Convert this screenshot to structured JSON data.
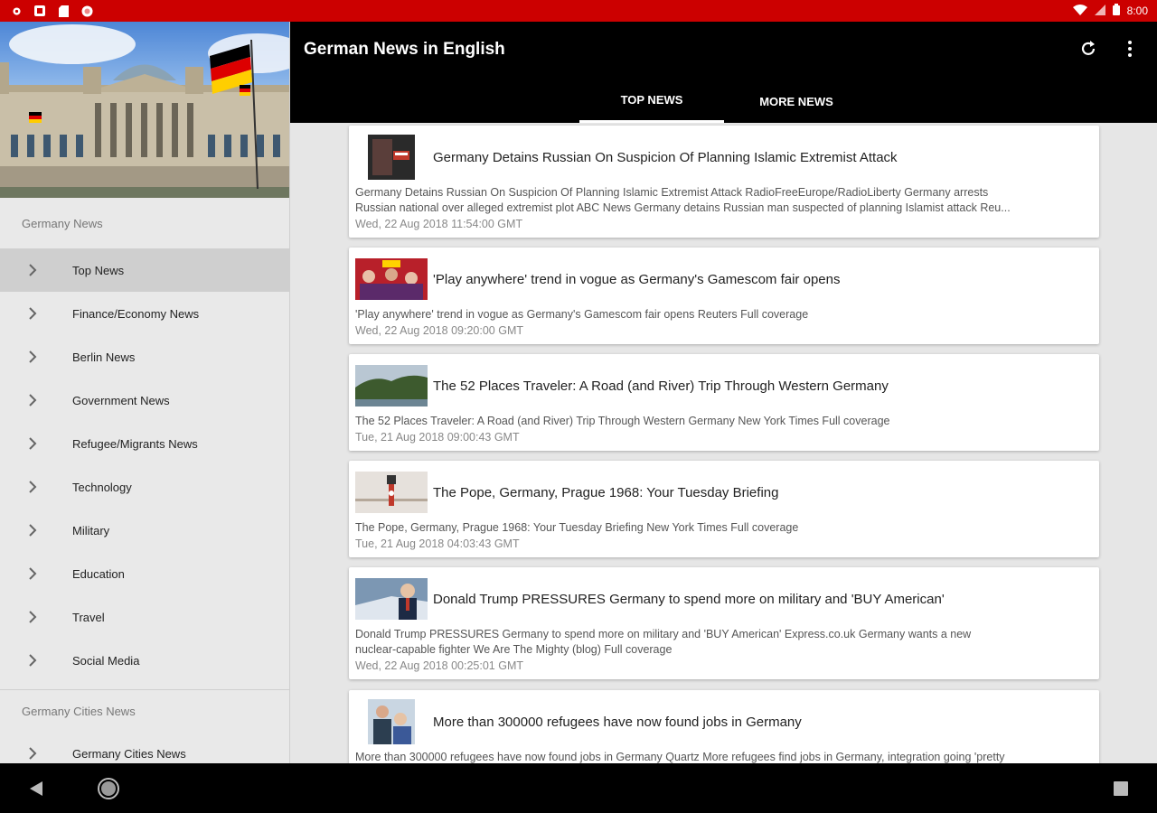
{
  "status_bar": {
    "time": "8:00"
  },
  "app": {
    "title": "German News in English"
  },
  "tabs": [
    {
      "label": "TOP NEWS"
    },
    {
      "label": "MORE NEWS"
    }
  ],
  "drawer": {
    "section1": "Germany News",
    "items": [
      {
        "label": "Top News"
      },
      {
        "label": "Finance/Economy News"
      },
      {
        "label": "Berlin News"
      },
      {
        "label": "Government News"
      },
      {
        "label": "Refugee/Migrants News"
      },
      {
        "label": "Technology"
      },
      {
        "label": "Military"
      },
      {
        "label": "Education"
      },
      {
        "label": "Travel"
      },
      {
        "label": "Social Media"
      }
    ],
    "section2": "Germany Cities News",
    "items2": [
      {
        "label": "Germany Cities News"
      }
    ]
  },
  "articles": [
    {
      "title": "Germany Detains Russian On Suspicion Of Planning Islamic Extremist Attack",
      "desc1": "Germany Detains Russian On Suspicion Of Planning Islamic Extremist Attack  RadioFreeEurope/RadioLiberty  Germany arrests",
      "desc2": "Russian national over alleged extremist plot  ABC News  Germany detains Russian man suspected of planning Islamist attack  Reu...",
      "date": "Wed, 22 Aug 2018 11:54:00 GMT"
    },
    {
      "title": "'Play anywhere' trend in vogue as Germany's Gamescom fair opens",
      "desc1": "'Play anywhere' trend in vogue as Germany's Gamescom fair opens  Reuters  Full coverage",
      "date": "Wed, 22 Aug 2018 09:20:00 GMT"
    },
    {
      "title": "The 52 Places Traveler: A Road (and River) Trip Through Western Germany",
      "desc1": "The 52 Places Traveler: A Road (and River) Trip Through Western Germany  New York Times  Full coverage",
      "date": "Tue, 21 Aug 2018 09:00:43 GMT"
    },
    {
      "title": "The Pope, Germany, Prague 1968: Your Tuesday Briefing",
      "desc1": "The Pope, Germany, Prague 1968: Your Tuesday Briefing  New York Times  Full coverage",
      "date": "Tue, 21 Aug 2018 04:03:43 GMT"
    },
    {
      "title": "Donald Trump PRESSURES Germany to spend more on military and 'BUY American'",
      "desc1": "Donald Trump PRESSURES Germany to spend more on military and 'BUY American'  Express.co.uk  Germany wants a new",
      "desc2": "nuclear-capable fighter  We Are The Mighty (blog)  Full coverage",
      "date": "Wed, 22 Aug 2018 00:25:01 GMT"
    },
    {
      "title": "More than 300000 refugees have now found jobs in Germany",
      "desc1": "More than 300000 refugees have now found jobs in Germany  Quartz  More refugees find jobs in Germany, integration going 'pretty"
    }
  ]
}
